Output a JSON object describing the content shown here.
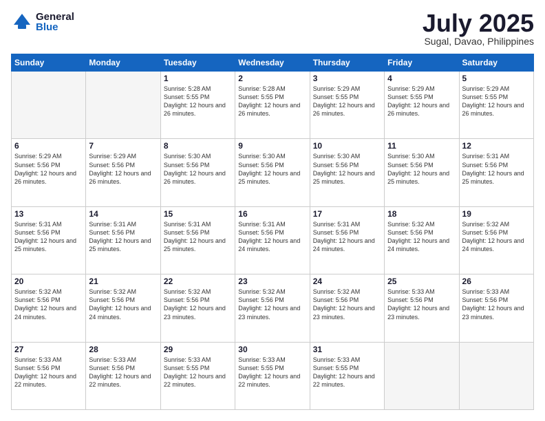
{
  "logo": {
    "general": "General",
    "blue": "Blue"
  },
  "title": "July 2025",
  "location": "Sugal, Davao, Philippines",
  "days_of_week": [
    "Sunday",
    "Monday",
    "Tuesday",
    "Wednesday",
    "Thursday",
    "Friday",
    "Saturday"
  ],
  "weeks": [
    [
      {
        "day": "",
        "sunrise": "",
        "sunset": "",
        "daylight": ""
      },
      {
        "day": "",
        "sunrise": "",
        "sunset": "",
        "daylight": ""
      },
      {
        "day": "1",
        "sunrise": "Sunrise: 5:28 AM",
        "sunset": "Sunset: 5:55 PM",
        "daylight": "Daylight: 12 hours and 26 minutes."
      },
      {
        "day": "2",
        "sunrise": "Sunrise: 5:28 AM",
        "sunset": "Sunset: 5:55 PM",
        "daylight": "Daylight: 12 hours and 26 minutes."
      },
      {
        "day": "3",
        "sunrise": "Sunrise: 5:29 AM",
        "sunset": "Sunset: 5:55 PM",
        "daylight": "Daylight: 12 hours and 26 minutes."
      },
      {
        "day": "4",
        "sunrise": "Sunrise: 5:29 AM",
        "sunset": "Sunset: 5:55 PM",
        "daylight": "Daylight: 12 hours and 26 minutes."
      },
      {
        "day": "5",
        "sunrise": "Sunrise: 5:29 AM",
        "sunset": "Sunset: 5:55 PM",
        "daylight": "Daylight: 12 hours and 26 minutes."
      }
    ],
    [
      {
        "day": "6",
        "sunrise": "Sunrise: 5:29 AM",
        "sunset": "Sunset: 5:56 PM",
        "daylight": "Daylight: 12 hours and 26 minutes."
      },
      {
        "day": "7",
        "sunrise": "Sunrise: 5:29 AM",
        "sunset": "Sunset: 5:56 PM",
        "daylight": "Daylight: 12 hours and 26 minutes."
      },
      {
        "day": "8",
        "sunrise": "Sunrise: 5:30 AM",
        "sunset": "Sunset: 5:56 PM",
        "daylight": "Daylight: 12 hours and 26 minutes."
      },
      {
        "day": "9",
        "sunrise": "Sunrise: 5:30 AM",
        "sunset": "Sunset: 5:56 PM",
        "daylight": "Daylight: 12 hours and 25 minutes."
      },
      {
        "day": "10",
        "sunrise": "Sunrise: 5:30 AM",
        "sunset": "Sunset: 5:56 PM",
        "daylight": "Daylight: 12 hours and 25 minutes."
      },
      {
        "day": "11",
        "sunrise": "Sunrise: 5:30 AM",
        "sunset": "Sunset: 5:56 PM",
        "daylight": "Daylight: 12 hours and 25 minutes."
      },
      {
        "day": "12",
        "sunrise": "Sunrise: 5:31 AM",
        "sunset": "Sunset: 5:56 PM",
        "daylight": "Daylight: 12 hours and 25 minutes."
      }
    ],
    [
      {
        "day": "13",
        "sunrise": "Sunrise: 5:31 AM",
        "sunset": "Sunset: 5:56 PM",
        "daylight": "Daylight: 12 hours and 25 minutes."
      },
      {
        "day": "14",
        "sunrise": "Sunrise: 5:31 AM",
        "sunset": "Sunset: 5:56 PM",
        "daylight": "Daylight: 12 hours and 25 minutes."
      },
      {
        "day": "15",
        "sunrise": "Sunrise: 5:31 AM",
        "sunset": "Sunset: 5:56 PM",
        "daylight": "Daylight: 12 hours and 25 minutes."
      },
      {
        "day": "16",
        "sunrise": "Sunrise: 5:31 AM",
        "sunset": "Sunset: 5:56 PM",
        "daylight": "Daylight: 12 hours and 24 minutes."
      },
      {
        "day": "17",
        "sunrise": "Sunrise: 5:31 AM",
        "sunset": "Sunset: 5:56 PM",
        "daylight": "Daylight: 12 hours and 24 minutes."
      },
      {
        "day": "18",
        "sunrise": "Sunrise: 5:32 AM",
        "sunset": "Sunset: 5:56 PM",
        "daylight": "Daylight: 12 hours and 24 minutes."
      },
      {
        "day": "19",
        "sunrise": "Sunrise: 5:32 AM",
        "sunset": "Sunset: 5:56 PM",
        "daylight": "Daylight: 12 hours and 24 minutes."
      }
    ],
    [
      {
        "day": "20",
        "sunrise": "Sunrise: 5:32 AM",
        "sunset": "Sunset: 5:56 PM",
        "daylight": "Daylight: 12 hours and 24 minutes."
      },
      {
        "day": "21",
        "sunrise": "Sunrise: 5:32 AM",
        "sunset": "Sunset: 5:56 PM",
        "daylight": "Daylight: 12 hours and 24 minutes."
      },
      {
        "day": "22",
        "sunrise": "Sunrise: 5:32 AM",
        "sunset": "Sunset: 5:56 PM",
        "daylight": "Daylight: 12 hours and 23 minutes."
      },
      {
        "day": "23",
        "sunrise": "Sunrise: 5:32 AM",
        "sunset": "Sunset: 5:56 PM",
        "daylight": "Daylight: 12 hours and 23 minutes."
      },
      {
        "day": "24",
        "sunrise": "Sunrise: 5:32 AM",
        "sunset": "Sunset: 5:56 PM",
        "daylight": "Daylight: 12 hours and 23 minutes."
      },
      {
        "day": "25",
        "sunrise": "Sunrise: 5:33 AM",
        "sunset": "Sunset: 5:56 PM",
        "daylight": "Daylight: 12 hours and 23 minutes."
      },
      {
        "day": "26",
        "sunrise": "Sunrise: 5:33 AM",
        "sunset": "Sunset: 5:56 PM",
        "daylight": "Daylight: 12 hours and 23 minutes."
      }
    ],
    [
      {
        "day": "27",
        "sunrise": "Sunrise: 5:33 AM",
        "sunset": "Sunset: 5:56 PM",
        "daylight": "Daylight: 12 hours and 22 minutes."
      },
      {
        "day": "28",
        "sunrise": "Sunrise: 5:33 AM",
        "sunset": "Sunset: 5:56 PM",
        "daylight": "Daylight: 12 hours and 22 minutes."
      },
      {
        "day": "29",
        "sunrise": "Sunrise: 5:33 AM",
        "sunset": "Sunset: 5:55 PM",
        "daylight": "Daylight: 12 hours and 22 minutes."
      },
      {
        "day": "30",
        "sunrise": "Sunrise: 5:33 AM",
        "sunset": "Sunset: 5:55 PM",
        "daylight": "Daylight: 12 hours and 22 minutes."
      },
      {
        "day": "31",
        "sunrise": "Sunrise: 5:33 AM",
        "sunset": "Sunset: 5:55 PM",
        "daylight": "Daylight: 12 hours and 22 minutes."
      },
      {
        "day": "",
        "sunrise": "",
        "sunset": "",
        "daylight": ""
      },
      {
        "day": "",
        "sunrise": "",
        "sunset": "",
        "daylight": ""
      }
    ]
  ]
}
